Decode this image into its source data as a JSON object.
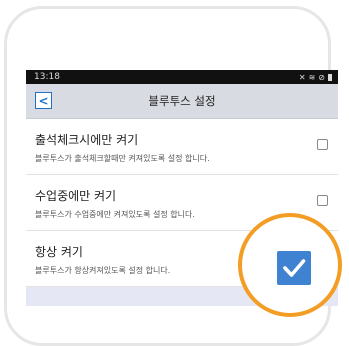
{
  "status_bar": {
    "time": "13:18",
    "icons": [
      "mute-icon",
      "wifi-icon",
      "do-not-disturb-icon",
      "battery-icon"
    ]
  },
  "header": {
    "title": "블루투스 설정",
    "back_icon": "chevron-left-icon"
  },
  "settings": [
    {
      "title": "출석체크시에만 켜기",
      "description": "블루투스가 출석체크할때만  켜져있도록 설정 합니다.",
      "checked": false
    },
    {
      "title": "수업중에만 켜기",
      "description": "블루투스가 수업중에만 켜져있도록 설정 합니다.",
      "checked": false
    },
    {
      "title": "항상 켜기",
      "description": "블루투스가 항상켜져있도록 설정 합니다.",
      "checked": true
    }
  ],
  "colors": {
    "accent": "#3e82d1",
    "highlight_ring": "#f49d24",
    "header_bg": "#d9dbe2"
  }
}
